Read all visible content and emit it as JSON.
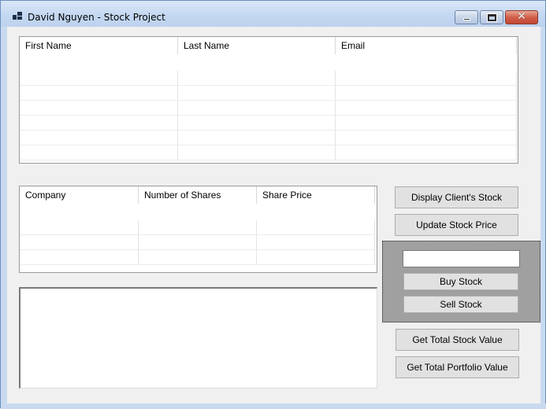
{
  "window": {
    "title": "David Nguyen - Stock Project"
  },
  "clients_grid": {
    "columns": [
      "First Name",
      "Last Name",
      "Email"
    ],
    "rows": [
      [
        "",
        "",
        ""
      ],
      [
        "",
        "",
        ""
      ],
      [
        "",
        "",
        ""
      ],
      [
        "",
        "",
        ""
      ],
      [
        "",
        "",
        ""
      ],
      [
        "",
        "",
        ""
      ]
    ]
  },
  "stocks_grid": {
    "columns": [
      "Company",
      "Number of Shares",
      "Share Price"
    ],
    "rows": [
      [
        "",
        "",
        ""
      ],
      [
        "",
        "",
        ""
      ],
      [
        "",
        "",
        ""
      ]
    ]
  },
  "buttons": {
    "display_clients_stock": "Display Client's Stock",
    "update_stock_price": "Update Stock Price",
    "buy_stock": "Buy Stock",
    "sell_stock": "Sell Stock",
    "get_total_stock_value": "Get Total Stock Value",
    "get_total_portfolio_value": "Get Total Portfolio Value"
  },
  "trade_panel": {
    "quantity_value": ""
  },
  "output": {
    "text": ""
  }
}
